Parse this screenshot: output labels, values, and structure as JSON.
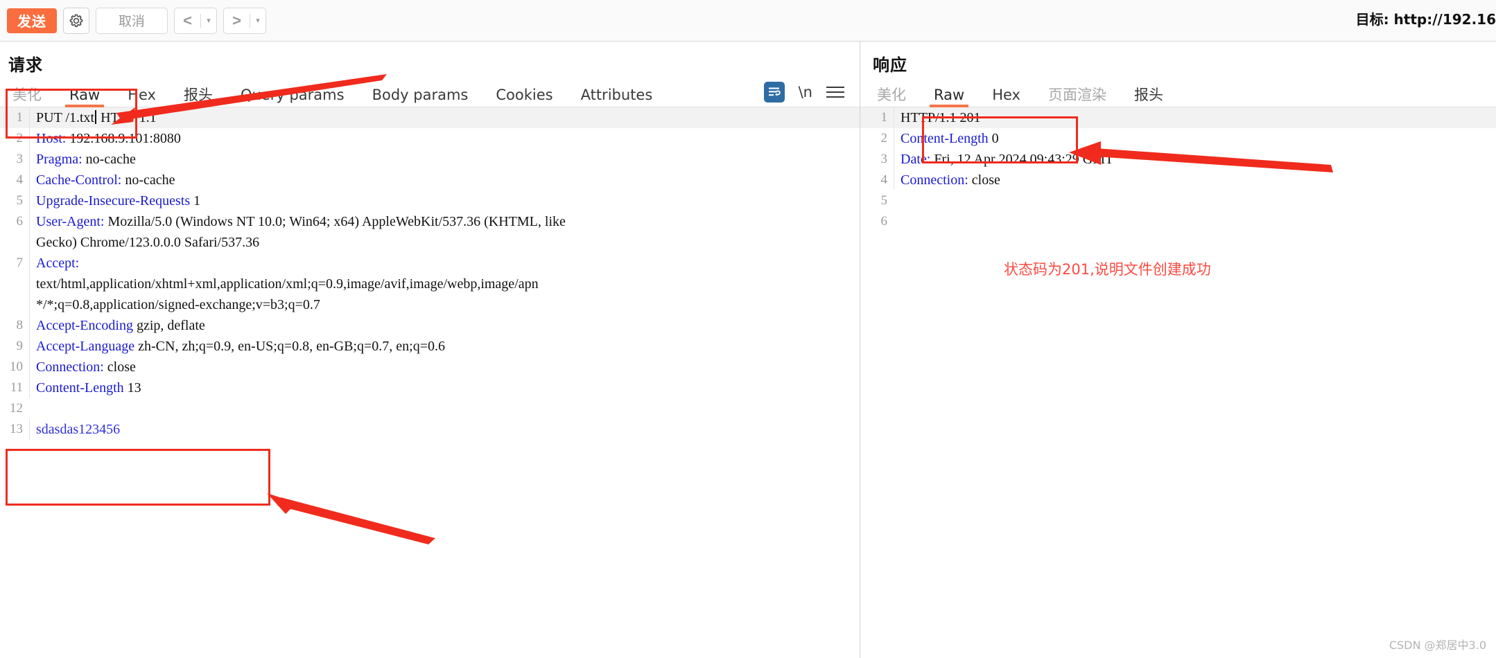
{
  "toolbar": {
    "send_label": "发送",
    "settings_icon": "gear-icon",
    "cancel_label": "取消",
    "prev_label": "<",
    "next_label": ">",
    "caret_label": "▾",
    "target_label": "目标: http://192.16"
  },
  "request": {
    "title": "请求",
    "tabs": [
      {
        "label": "美化",
        "active": false,
        "muted": true
      },
      {
        "label": "Raw",
        "active": true,
        "muted": false
      },
      {
        "label": "Hex",
        "active": false,
        "muted": false
      },
      {
        "label": "报头",
        "active": false,
        "muted": false
      },
      {
        "label": "Query params",
        "active": false,
        "muted": false
      },
      {
        "label": "Body params",
        "active": false,
        "muted": false
      },
      {
        "label": "Cookies",
        "active": false,
        "muted": false
      },
      {
        "label": "Attributes",
        "active": false,
        "muted": false
      }
    ],
    "icons": [
      {
        "name": "word-wrap-icon",
        "glyph": "⮐"
      },
      {
        "name": "newline-icon",
        "glyph": "\\n"
      },
      {
        "name": "menu-icon",
        "glyph": "≡"
      }
    ],
    "lines": [
      {
        "num": "1",
        "name": "PUT /1.txt",
        "value": " HTTP/1.1",
        "style": "request-line",
        "caret": true
      },
      {
        "num": "2",
        "name": "Host:",
        "value": " 192.168.9.101:8080",
        "style": "header"
      },
      {
        "num": "3",
        "name": "Pragma:",
        "value": " no-cache",
        "style": "header"
      },
      {
        "num": "4",
        "name": "Cache-Control:",
        "value": " no-cache",
        "style": "header"
      },
      {
        "num": "5",
        "name": "Upgrade-Insecure-Requests",
        "value": " 1",
        "style": "header"
      },
      {
        "num": "6",
        "name": "User-Agent:",
        "value": " Mozilla/5.0 (Windows NT 10.0; Win64; x64) AppleWebKit/537.36 (KHTML, like",
        "style": "header"
      },
      {
        "num": "",
        "name": "",
        "value": "Gecko) Chrome/123.0.0.0 Safari/537.36",
        "style": "cont"
      },
      {
        "num": "7",
        "name": "Accept:",
        "value": "",
        "style": "header"
      },
      {
        "num": "",
        "name": "",
        "value": "text/html,application/xhtml+xml,application/xml;q=0.9,image/avif,image/webp,image/apn",
        "style": "cont"
      },
      {
        "num": "",
        "name": "",
        "value": "*/*;q=0.8,application/signed-exchange;v=b3;q=0.7",
        "style": "cont"
      },
      {
        "num": "8",
        "name": "Accept-Encoding",
        "value": " gzip, deflate",
        "style": "header"
      },
      {
        "num": "9",
        "name": "Accept-Language",
        "value": " zh-CN, zh;q=0.9, en-US;q=0.8, en-GB;q=0.7, en;q=0.6",
        "style": "header"
      },
      {
        "num": "10",
        "name": "Connection:",
        "value": " close",
        "style": "header"
      },
      {
        "num": "11",
        "name": "Content-Length",
        "value": " 13",
        "style": "header"
      },
      {
        "num": "12",
        "name": "",
        "value": "",
        "style": "blank"
      },
      {
        "num": "13",
        "name": "",
        "value": "sdasdas123456",
        "style": "body"
      }
    ]
  },
  "response": {
    "title": "响应",
    "tabs": [
      {
        "label": "美化",
        "active": false,
        "muted": true
      },
      {
        "label": "Raw",
        "active": true,
        "muted": false
      },
      {
        "label": "Hex",
        "active": false,
        "muted": false
      },
      {
        "label": "页面渲染",
        "active": false,
        "muted": true
      },
      {
        "label": "报头",
        "active": false,
        "muted": false
      }
    ],
    "lines": [
      {
        "num": "1",
        "name": "HTTP/1.1 201",
        "value": "",
        "style": "status-line"
      },
      {
        "num": "2",
        "name": "Content-Length",
        "value": " 0",
        "style": "header"
      },
      {
        "num": "3",
        "name": "Date:",
        "value": " Fri, 12 Apr 2024 09:43:29 GMT",
        "style": "header"
      },
      {
        "num": "4",
        "name": "Connection:",
        "value": " close",
        "style": "header"
      },
      {
        "num": "5",
        "name": "",
        "value": "",
        "style": "blank"
      },
      {
        "num": "6",
        "name": "",
        "value": "",
        "style": "blank"
      }
    ]
  },
  "annotations": {
    "note_201": "状态码为201,说明文件创建成功",
    "accent_red": "#f02b1d",
    "accent_orange": "#f4764a",
    "accent_blue": "#1a1ad1"
  },
  "footer": {
    "watermark": "CSDN @郑居中3.0"
  }
}
